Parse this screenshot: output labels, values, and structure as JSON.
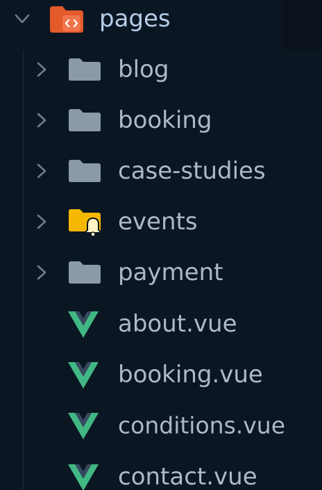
{
  "explorer": {
    "root": {
      "label": "pages",
      "chevron_icon": "chevron-down-icon",
      "folder_icon": "folder-pages-icon",
      "expanded": true
    },
    "folders": [
      {
        "label": "blog",
        "icon": "folder-icon",
        "color": "#8a9aa9"
      },
      {
        "label": "booking",
        "icon": "folder-icon",
        "color": "#8a9aa9"
      },
      {
        "label": "case-studies",
        "icon": "folder-icon",
        "color": "#8a9aa9"
      },
      {
        "label": "events",
        "icon": "folder-event-icon",
        "color": "#f5b800"
      },
      {
        "label": "payment",
        "icon": "folder-icon",
        "color": "#8a9aa9"
      }
    ],
    "files": [
      {
        "label": "about.vue",
        "icon": "vue-file-icon"
      },
      {
        "label": "booking.vue",
        "icon": "vue-file-icon"
      },
      {
        "label": "conditions.vue",
        "icon": "vue-file-icon"
      },
      {
        "label": "contact.vue",
        "icon": "vue-file-icon"
      }
    ],
    "colors": {
      "background": "#0b1623",
      "text": "#aeb9c6",
      "root_text": "#b7cde8",
      "chevron": "#6e7d8c",
      "folder": "#8a9aa9",
      "pages_folder": "#e35a2b",
      "events_folder": "#f5b800",
      "vue_green": "#41b883",
      "vue_dark": "#35495e"
    }
  }
}
